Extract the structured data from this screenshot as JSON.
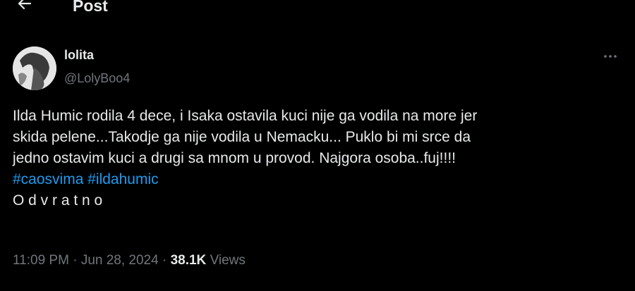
{
  "header": {
    "back_icon": "arrow-left-icon",
    "title": "Post"
  },
  "author": {
    "display_name": "lolita",
    "handle": "@LolyBoo4",
    "avatar_icon": "avatar-image"
  },
  "more_icon": "more-horizontal-icon",
  "tweet": {
    "lines": [
      "Ilda Humic rodila 4 dece, i Isaka ostavila kuci nije ga vodila na more jer",
      "skida pelene...Takodje ga nije vodila u Nemacku... Puklo bi mi srce da",
      "jedno ostavim kuci a drugi sa mnom u provod. Najgora osoba..fuj!!!!"
    ],
    "hashtags": [
      "#caosvima",
      "#ildahumic"
    ],
    "signature": "O d v r a t n o"
  },
  "meta": {
    "time": "11:09 PM",
    "separator": "·",
    "date": "Jun 28, 2024",
    "views_count": "38.1K",
    "views_label": "Views"
  },
  "colors": {
    "background": "#000000",
    "text": "#e7e9ea",
    "secondary": "#71767b",
    "link": "#1d9bf0"
  }
}
